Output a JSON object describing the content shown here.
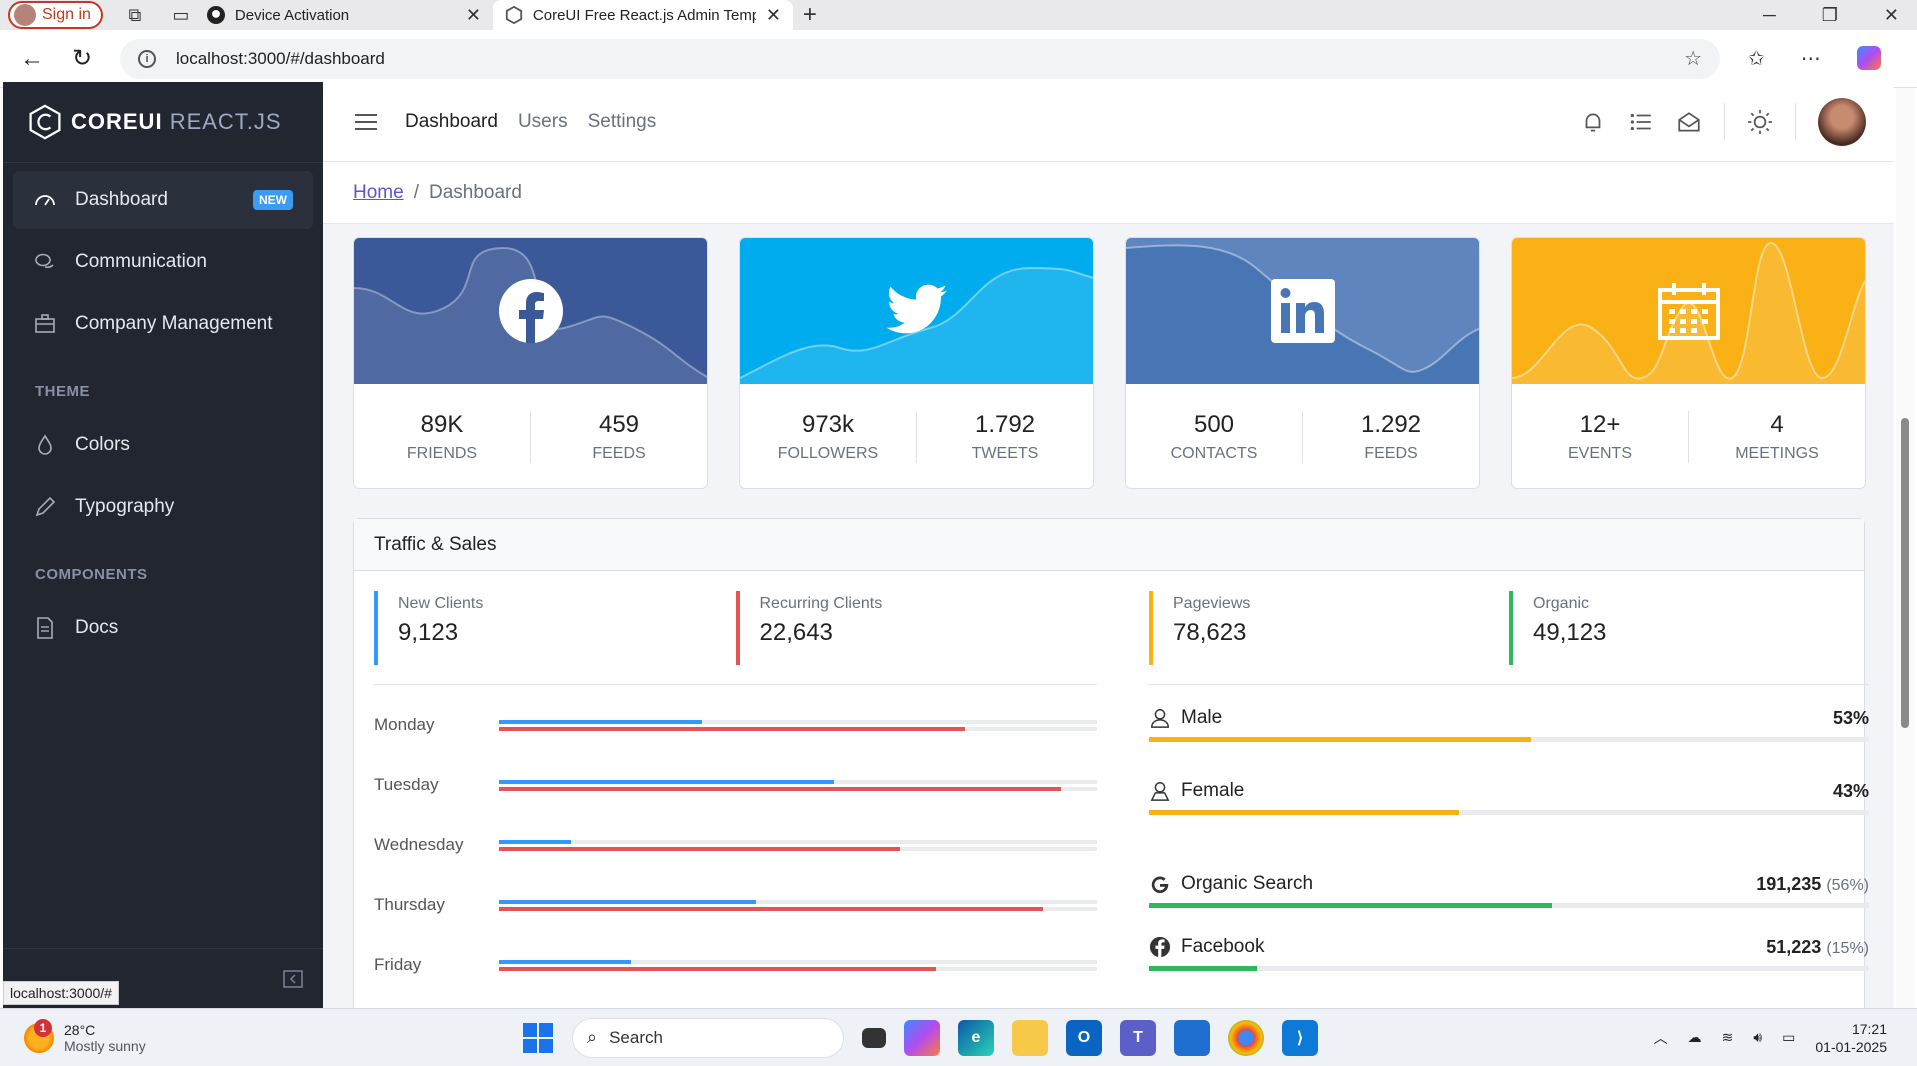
{
  "browser": {
    "signin_label": "Sign in",
    "tabs": [
      {
        "title": "Device Activation",
        "icon": "github-icon"
      },
      {
        "title": "CoreUI Free React.js Admin Templ",
        "icon": "coreui-icon"
      }
    ],
    "url": "localhost:3000/#/dashboard",
    "status_url": "localhost:3000/#"
  },
  "sidebar": {
    "brand_bold": "COREUI",
    "brand_light": "REACT.JS",
    "items_top": [
      {
        "label": "Dashboard",
        "badge": "NEW",
        "icon": "speedometer-icon"
      },
      {
        "label": "Communication",
        "icon": "chat-icon"
      },
      {
        "label": "Company Management",
        "icon": "briefcase-icon"
      }
    ],
    "theme_title": "THEME",
    "theme_items": [
      {
        "label": "Colors",
        "icon": "drop-icon"
      },
      {
        "label": "Typography",
        "icon": "pencil-icon"
      }
    ],
    "components_title": "COMPONENTS",
    "component_items": [
      {
        "label": "Docs",
        "icon": "document-icon"
      }
    ]
  },
  "header": {
    "nav": [
      "Dashboard",
      "Users",
      "Settings"
    ]
  },
  "breadcrumb": {
    "home": "Home",
    "current": "Dashboard"
  },
  "social_cards": [
    {
      "network": "facebook",
      "color": "#3b5998",
      "left_value": "89K",
      "left_label": "friends",
      "right_value": "459",
      "right_label": "feeds"
    },
    {
      "network": "twitter",
      "color": "#00aced",
      "left_value": "973k",
      "left_label": "followers",
      "right_value": "1.792",
      "right_label": "tweets"
    },
    {
      "network": "linkedin",
      "color": "#4875b4",
      "left_value": "500",
      "left_label": "contacts",
      "right_value": "1.292",
      "right_label": "feeds"
    },
    {
      "network": "events",
      "color": "#f9b115",
      "left_value": "12+",
      "left_label": "events",
      "right_value": "4",
      "right_label": "meetings"
    }
  ],
  "traffic": {
    "title": "Traffic & Sales",
    "kpis": [
      {
        "label": "New Clients",
        "value": "9,123",
        "color": "#3399ff"
      },
      {
        "label": "Recurring Clients",
        "value": "22,643",
        "color": "#e55353"
      },
      {
        "label": "Pageviews",
        "value": "78,623",
        "color": "#f9b115"
      },
      {
        "label": "Organic",
        "value": "49,123",
        "color": "#2eb85c"
      }
    ],
    "days": [
      {
        "day": "Monday",
        "new": 34,
        "recurring": 78
      },
      {
        "day": "Tuesday",
        "new": 56,
        "recurring": 94
      },
      {
        "day": "Wednesday",
        "new": 12,
        "recurring": 67
      },
      {
        "day": "Thursday",
        "new": 43,
        "recurring": 91
      },
      {
        "day": "Friday",
        "new": 22,
        "recurring": 73
      }
    ],
    "genders": [
      {
        "label": "Male",
        "pct": "53%",
        "value": 53,
        "icon": "user-icon"
      },
      {
        "label": "Female",
        "pct": "43%",
        "value": 43,
        "icon": "user-female-icon"
      }
    ],
    "sources": [
      {
        "label": "Organic Search",
        "value": "191,235",
        "pct": "(56%)",
        "fill": 56,
        "icon": "google-icon"
      },
      {
        "label": "Facebook",
        "value": "51,223",
        "pct": "(15%)",
        "fill": 15,
        "icon": "facebook-icon"
      }
    ]
  },
  "taskbar": {
    "temp": "28°C",
    "weather": "Mostly sunny",
    "weather_alert": "1",
    "search": "Search",
    "time": "17:21",
    "date": "01-01-2025"
  }
}
